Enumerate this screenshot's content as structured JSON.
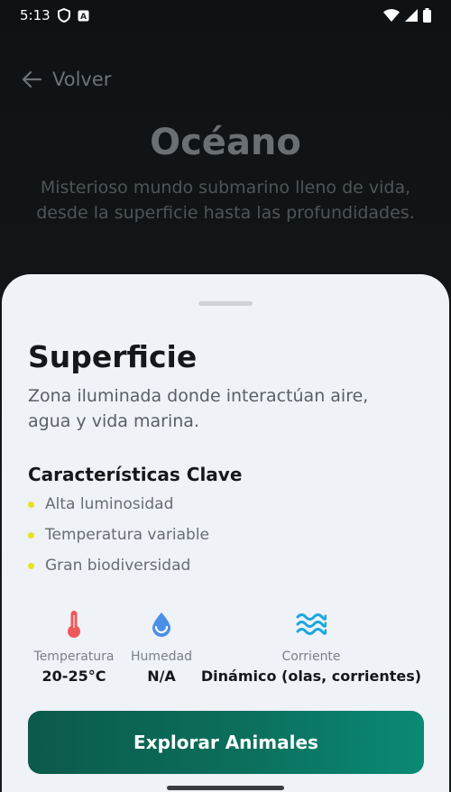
{
  "status_bar": {
    "time": "5:13",
    "icons": [
      "shield-icon",
      "font-a-icon",
      "wifi-icon",
      "signal-icon",
      "battery-icon"
    ]
  },
  "header": {
    "back_label": "Volver",
    "title": "Océano",
    "subtitle": "Misterioso mundo submarino lleno de vida, desde la superficie hasta las profundidades."
  },
  "sheet": {
    "title": "Superficie",
    "description": "Zona iluminada donde interactúan aire, agua y vida marina.",
    "key_features_title": "Características Clave",
    "features": [
      "Alta luminosidad",
      "Temperatura variable",
      "Gran biodiversidad"
    ],
    "stats": {
      "temperature": {
        "label": "Temperatura",
        "value": "20-25°C",
        "icon": "thermometer-icon"
      },
      "humidity": {
        "label": "Humedad",
        "value": "N/A",
        "icon": "water-drop-icon"
      },
      "current": {
        "label": "Corriente",
        "value": "Dinámico (olas, corrientes)",
        "icon": "waves-icon"
      }
    },
    "explore_button": "Explorar Animales"
  },
  "colors": {
    "accent_button": "#0b6f5c",
    "bullet": "#e7e320",
    "sheet_bg": "#eff2f7"
  }
}
